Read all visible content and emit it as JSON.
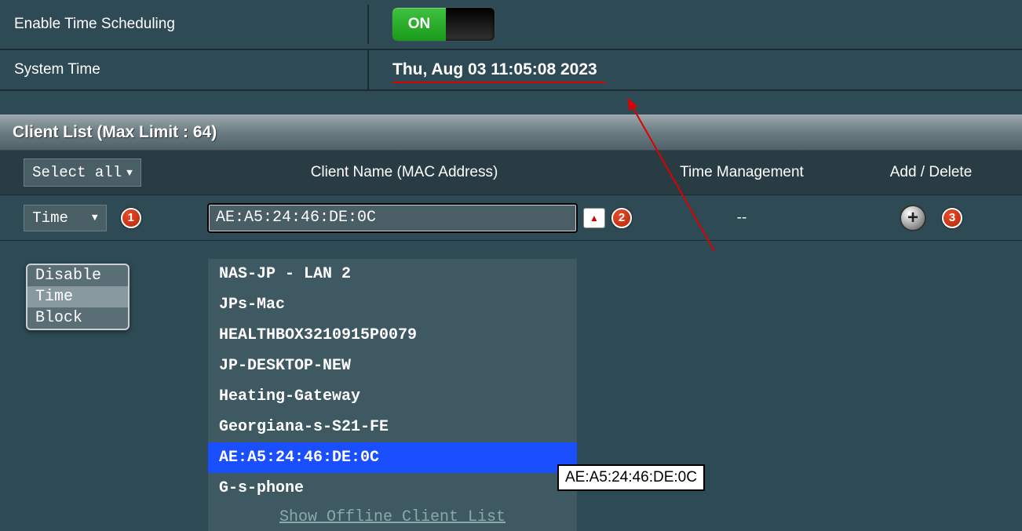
{
  "settings": {
    "enable_label": "Enable Time Scheduling",
    "toggle_text": "ON",
    "system_time_label": "System Time",
    "system_time_value": "Thu, Aug 03 11:05:08 2023"
  },
  "section": {
    "title": "Client List (Max Limit : 64)"
  },
  "columns": {
    "select_all": "Select all",
    "client_name": "Client Name (MAC Address)",
    "time_mgmt": "Time Management",
    "add_delete": "Add / Delete"
  },
  "row": {
    "mode": "Time",
    "mac_value": "AE:A5:24:46:DE:0C",
    "time_value": "--"
  },
  "mode_options": [
    "Disable",
    "Time",
    "Block"
  ],
  "client_options": [
    "NAS-JP - LAN 2",
    "JPs-Mac",
    "HEALTHBOX3210915P0079",
    "JP-DESKTOP-NEW",
    "Heating-Gateway",
    "Georgiana-s-S21-FE",
    "AE:A5:24:46:DE:0C",
    "G-s-phone"
  ],
  "client_selected_index": 6,
  "show_offline": "Show Offline Client List",
  "tooltip": "AE:A5:24:46:DE:0C",
  "badges": {
    "b1": "1",
    "b2": "2",
    "b3": "3"
  }
}
